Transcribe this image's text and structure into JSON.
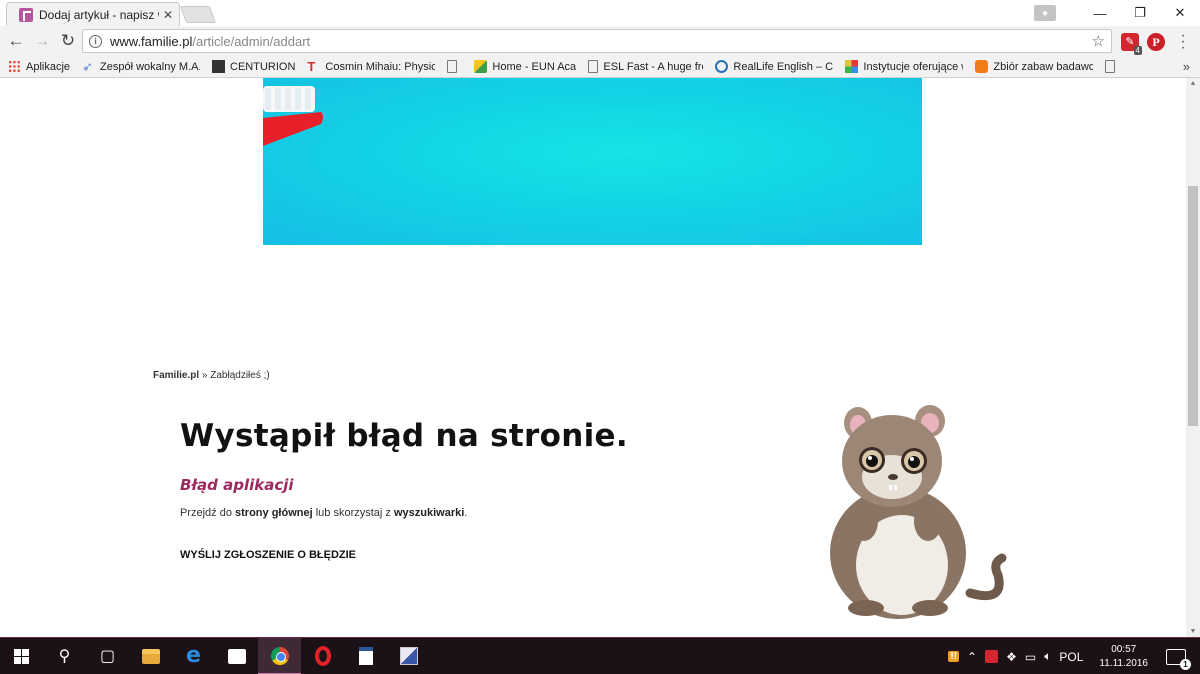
{
  "browser": {
    "tab_title": "Dodaj artykuł - napisz wł",
    "tab_close": "✕",
    "url_host": "www.familie.pl",
    "url_path": "/article/admin/addart",
    "window_controls": [
      "—",
      "❐",
      "✕"
    ]
  },
  "bookmarks": [
    {
      "label": "Aplikacje",
      "icon": "apps-grid-icon"
    },
    {
      "label": "Zespół wokalny M.A.T",
      "icon": "paper-plane-icon"
    },
    {
      "label": "CENTURION",
      "icon": "column-building-icon"
    },
    {
      "label": "Cosmin Mihaiu: Physic",
      "icon": "ted-t-icon"
    },
    {
      "label": "",
      "icon": "blank-page-icon"
    },
    {
      "label": "Home - EUN Academ",
      "icon": "eun-academy-icon"
    },
    {
      "label": "ESL Fast - A huge free",
      "icon": "blank-page-icon"
    },
    {
      "label": "RealLife English – Con",
      "icon": "reallife-icon"
    },
    {
      "label": "Instytucje oferujące w",
      "icon": "colorful-square-icon"
    },
    {
      "label": "Zbiór zabaw badawcz",
      "icon": "blogger-icon"
    },
    {
      "label": "",
      "icon": "blank-page-icon"
    }
  ],
  "bookmarks_more": "»",
  "page": {
    "breadcrumb_home": "Familie.pl",
    "breadcrumb_sep": " » ",
    "breadcrumb_current": "Zabłądziłeś ;)",
    "error_title": "Wystąpił błąd na stronie.",
    "error_subtitle": "Błąd aplikacji",
    "desc_prefix": "Przejdź do ",
    "desc_link1": "strony głównej",
    "desc_middle": " lub skorzystaj z ",
    "desc_link2": "wyszukiwarki",
    "desc_suffix": ".",
    "report_link": "WYŚLIJ ZGŁOSZENIE O BŁĘDZIE"
  },
  "taskbar": {
    "tray_language": "POL",
    "tray_warning": "!!",
    "clock_time": "00:57",
    "clock_date": "11.11.2016",
    "notification_count": "1"
  },
  "colors": {
    "accent_subtitle": "#9c2a5f",
    "hero_cyan": "#16d4e4",
    "taskbar_bg": "#1d1118"
  }
}
